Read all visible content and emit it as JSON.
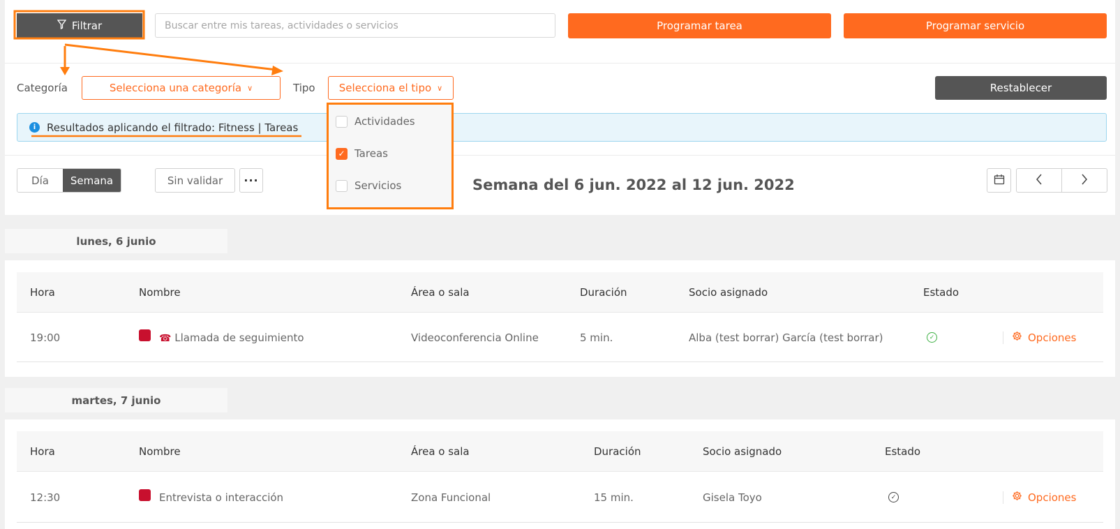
{
  "toolbar": {
    "filter_label": "Filtrar",
    "search_placeholder": "Buscar entre mis tareas, actividades o servicios",
    "schedule_task_label": "Programar tarea",
    "schedule_service_label": "Programar servicio"
  },
  "filters": {
    "category_label": "Categoría",
    "category_placeholder": "Selecciona una categoría",
    "type_label": "Tipo",
    "type_placeholder": "Selecciona el tipo",
    "reset_label": "Restablecer",
    "type_options": [
      {
        "label": "Actividades",
        "checked": false
      },
      {
        "label": "Tareas",
        "checked": true
      },
      {
        "label": "Servicios",
        "checked": false
      }
    ]
  },
  "info_banner": {
    "text": "Resultados aplicando el filtrado: Fitness | Tareas"
  },
  "view": {
    "day_label": "Día",
    "week_label": "Semana",
    "unvalidated_label": "Sin validar",
    "more_label": "···",
    "week_title": "Semana del 6 jun. 2022 al 12 jun. 2022"
  },
  "table_headers": {
    "time": "Hora",
    "name": "Nombre",
    "area": "Área o sala",
    "duration": "Duración",
    "member": "Socio asignado",
    "status": "Estado"
  },
  "days": [
    {
      "label": "lunes, 6 junio",
      "rows": [
        {
          "time": "19:00",
          "name": "Llamada de seguimiento",
          "area": "Videoconferencia Online",
          "duration": "5 min.",
          "member": "Alba (test borrar) García (test borrar)",
          "status": "validated",
          "options": "Opciones"
        }
      ]
    },
    {
      "label": "martes, 7 junio",
      "rows": [
        {
          "time": "12:30",
          "name": "Entrevista o interacción",
          "area": "Zona Funcional",
          "duration": "15 min.",
          "member": "Gisela Toyo",
          "status": "pending",
          "options": "Opciones"
        }
      ]
    }
  ],
  "colors": {
    "accent": "#ff6a1f",
    "highlight": "#ff7d0e",
    "dark_button": "#555555",
    "task_color": "#c8102e",
    "status_ok": "#3cb043"
  }
}
